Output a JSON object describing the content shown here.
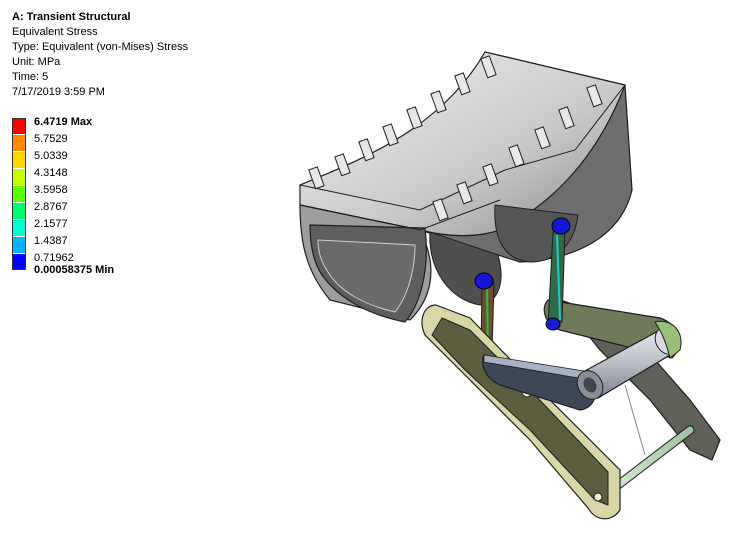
{
  "info": {
    "title": "A: Transient Structural",
    "result": "Equivalent Stress",
    "type": "Type: Equivalent (von-Mises) Stress",
    "unit": "Unit: MPa",
    "time": "Time: 5",
    "date": "7/17/2019 3:59 PM"
  },
  "legend": {
    "labels": [
      "6.4719 Max",
      "5.7529",
      "5.0339",
      "4.3148",
      "3.5958",
      "2.8767",
      "2.1577",
      "1.4387",
      "0.71962",
      "0.00058375 Min"
    ],
    "colors": [
      "#ff0000",
      "#ff8c00",
      "#ffd700",
      "#c8ff00",
      "#5aff00",
      "#00ff6e",
      "#00ffd2",
      "#00b4ff",
      "#0000ff"
    ]
  }
}
